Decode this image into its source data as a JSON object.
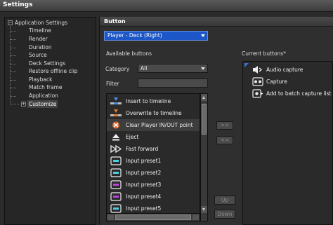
{
  "window": {
    "title": "Settings"
  },
  "tree": {
    "root": "Application Settings",
    "children": [
      "Timeline",
      "Render",
      "Duration",
      "Source",
      "Deck Settings",
      "Restore offline clip",
      "Playback",
      "Match frame",
      "Application",
      "Customize"
    ],
    "selected": "Customize"
  },
  "panel": {
    "title": "Button",
    "button_set": "Player - Deck (Right)",
    "available_label": "Available buttons",
    "category_label": "Category",
    "category_value": "All",
    "filter_label": "Filter",
    "filter_value": "",
    "current_label": "Current buttons*",
    "available": [
      {
        "label": "Insert to timeline",
        "icon": "insert-timeline-icon"
      },
      {
        "label": "Overwrite to timeline",
        "icon": "overwrite-timeline-icon"
      },
      {
        "label": "Clear Player IN/OUT point",
        "icon": "clear-in-out-icon",
        "selected": true
      },
      {
        "label": "Eject",
        "icon": "eject-icon"
      },
      {
        "label": "Fast forward",
        "icon": "fast-forward-icon"
      },
      {
        "label": "Input preset1",
        "icon": "input-preset-icon"
      },
      {
        "label": "Input preset2",
        "icon": "input-preset-icon"
      },
      {
        "label": "Input preset3",
        "icon": "input-preset-icon"
      },
      {
        "label": "Input preset4",
        "icon": "input-preset-icon"
      },
      {
        "label": "Input preset5",
        "icon": "input-preset-icon"
      }
    ],
    "current": [
      {
        "label": "Audio capture",
        "icon": "audio-capture-icon"
      },
      {
        "label": "Capture",
        "icon": "capture-icon"
      },
      {
        "label": "Add to batch capture list",
        "icon": "batch-capture-icon"
      }
    ],
    "add_button": ">>",
    "remove_button": "<<",
    "up_button": "Up",
    "down_button": "Down"
  },
  "colors": {
    "selection_blue": "#1d56c6",
    "background": "#2f2f2f"
  }
}
